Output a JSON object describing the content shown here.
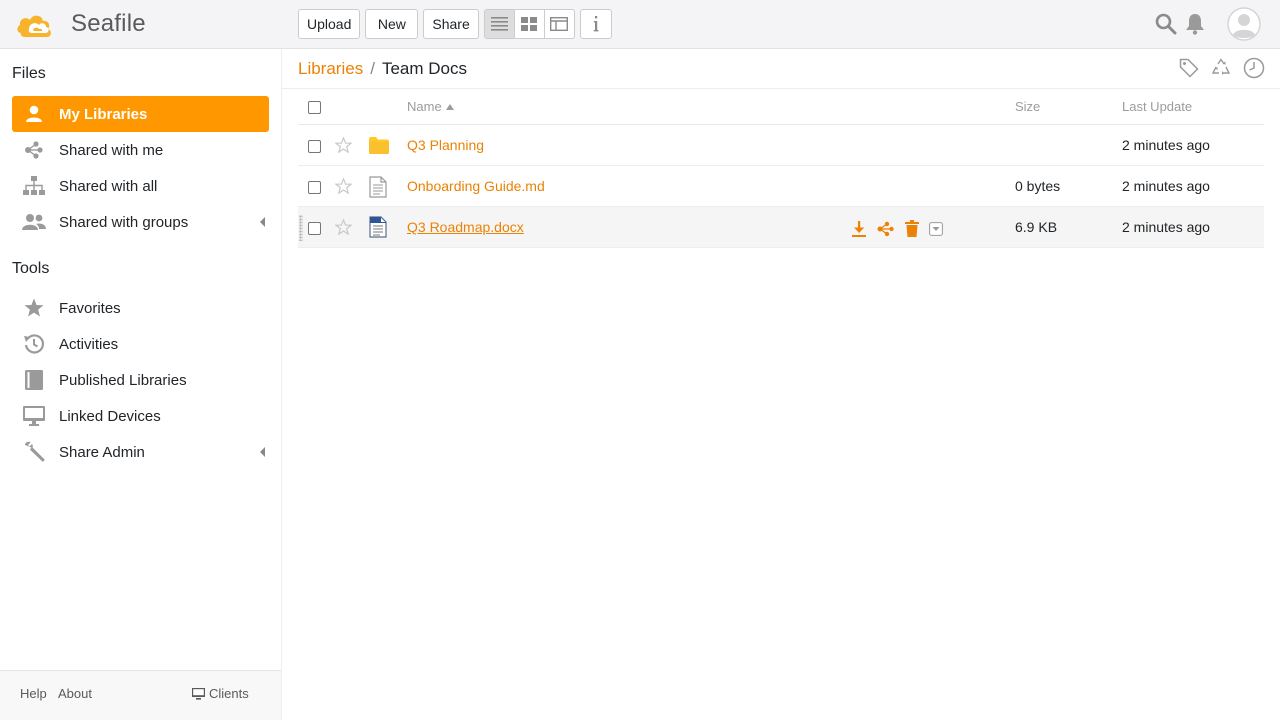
{
  "app": {
    "logo_text": "Seafile"
  },
  "toolbar": {
    "upload": "Upload",
    "new": "New",
    "share": "Share"
  },
  "sidebar": {
    "files_heading": "Files",
    "tools_heading": "Tools",
    "files_items": [
      {
        "label": "My Libraries",
        "icon": "user-icon",
        "active": true
      },
      {
        "label": "Shared with me",
        "icon": "share-icon"
      },
      {
        "label": "Shared with all",
        "icon": "org-icon"
      },
      {
        "label": "Shared with groups",
        "icon": "group-icon"
      }
    ],
    "tools_items": [
      {
        "label": "Favorites",
        "icon": "star-icon"
      },
      {
        "label": "Activities",
        "icon": "history-icon"
      },
      {
        "label": "Published Libraries",
        "icon": "book-icon"
      },
      {
        "label": "Linked Devices",
        "icon": "monitor-icon"
      },
      {
        "label": "Share Admin",
        "icon": "wrench-icon"
      }
    ],
    "footer": {
      "help": "Help",
      "about": "About",
      "clients": "Clients"
    }
  },
  "path": {
    "root": "Libraries",
    "separator": "/",
    "current": "Team Docs"
  },
  "table": {
    "headers": {
      "name": "Name",
      "size": "Size",
      "last_update": "Last Update"
    },
    "rows": [
      {
        "name": "Q3 Planning",
        "type": "folder",
        "size": "",
        "updated": "2 minutes ago"
      },
      {
        "name": "Onboarding Guide.md",
        "type": "markdown",
        "size": "0 bytes",
        "updated": "2 minutes ago"
      },
      {
        "name": "Q3 Roadmap.docx",
        "type": "word",
        "size": "6.9 KB",
        "updated": "2 minutes ago",
        "hovered": true
      }
    ]
  },
  "colors": {
    "accent": "#ff9800",
    "link": "#eb8205",
    "header_bg": "#f4f4f7"
  }
}
